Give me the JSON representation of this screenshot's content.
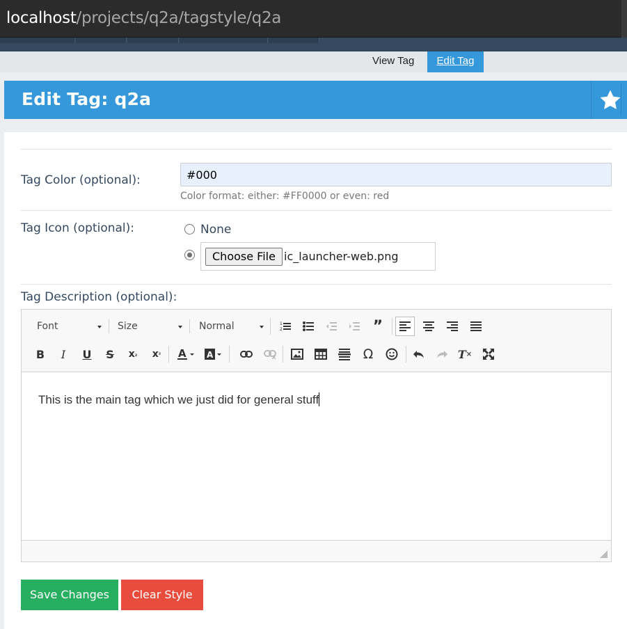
{
  "browser": {
    "url_host": "localhost",
    "url_path": "/projects/q2a/tagstyle/q2a"
  },
  "subnav": {
    "view_tag": "View Tag",
    "edit_tag": "Edit Tag"
  },
  "page": {
    "title": "Edit Tag: q2a"
  },
  "form": {
    "color_label": "Tag Color (optional):",
    "color_value": "#000",
    "color_hint": "Color format: either: #FF0000 or even: red",
    "icon_label": "Tag Icon (optional):",
    "icon_none": "None",
    "icon_selected": "file",
    "choose_file": "Choose File",
    "file_name": "ic_launcher-web.png",
    "description_label": "Tag Description (optional):"
  },
  "editor": {
    "font_combo": "Font",
    "size_combo": "Size",
    "format_combo": "Normal",
    "content": "This is the main tag which we just did for general stuff",
    "active_align": "align-left"
  },
  "buttons": {
    "save": "Save Changes",
    "clear": "Clear Style"
  },
  "colors": {
    "accent": "#3498db",
    "save": "#27ae60",
    "clear": "#e74c3c",
    "dark_nav": "#34495e"
  }
}
